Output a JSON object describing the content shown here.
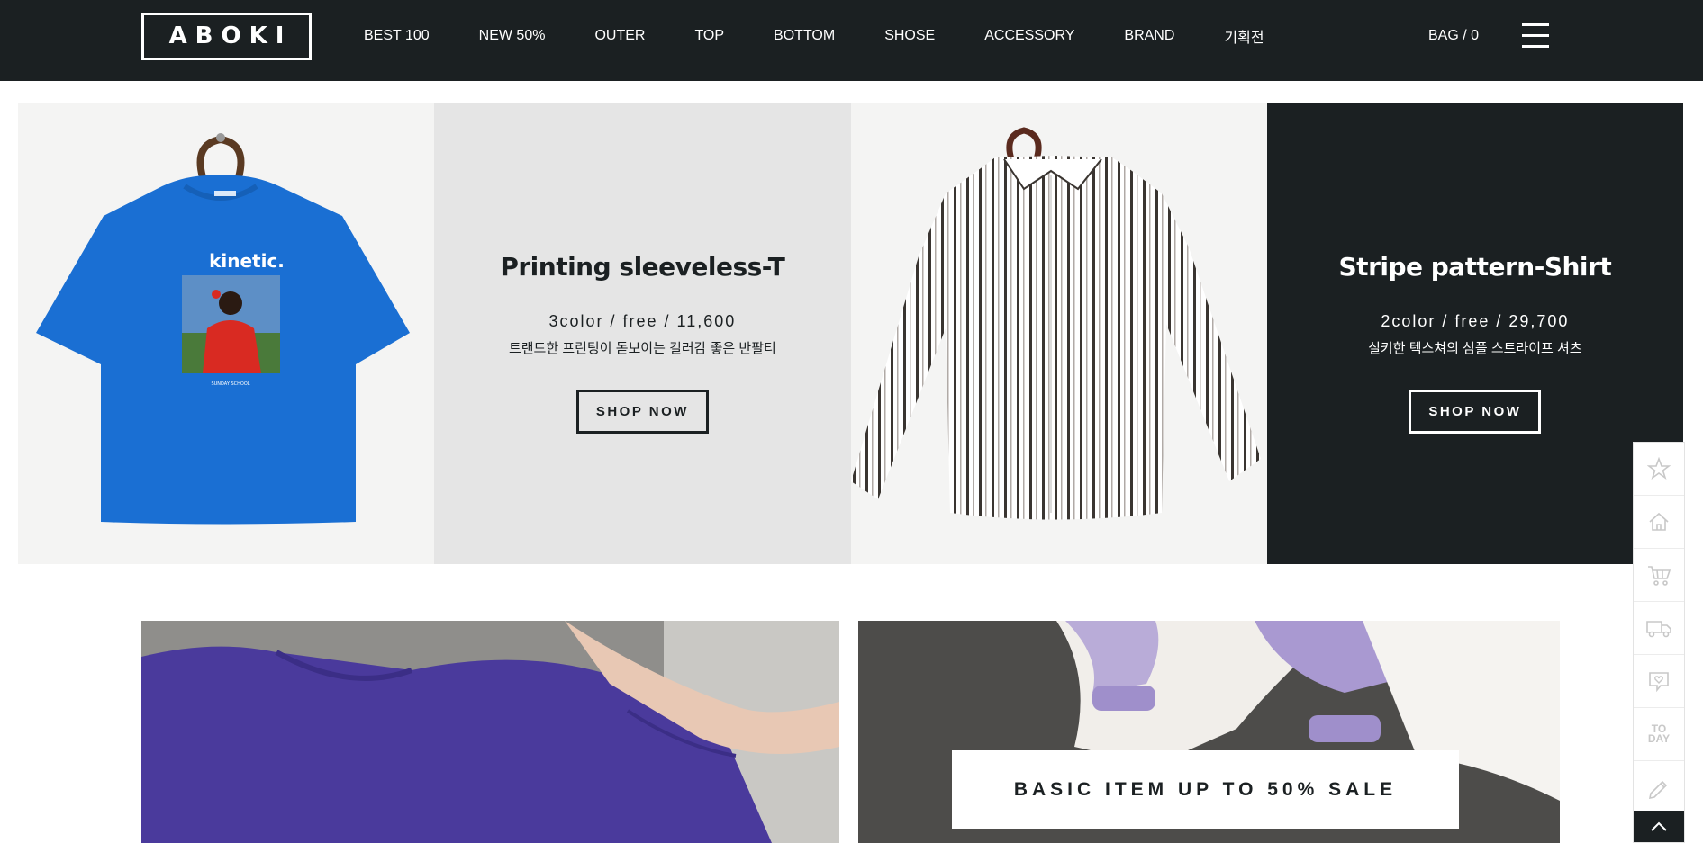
{
  "header": {
    "logo": "ABOKI",
    "nav": [
      "BEST 100",
      "NEW 50%",
      "OUTER",
      "TOP",
      "BOTTOM",
      "SHOSE",
      "ACCESSORY",
      "BRAND",
      "기획전"
    ],
    "bag": "BAG / 0",
    "menu_icon": "hamburger-menu-icon"
  },
  "banner": {
    "panels": [
      {
        "type": "image",
        "icon": "blue-kinetic-tshirt-image",
        "print_text": "kinetic.",
        "tag_text": "SUNDAY SCHOOL"
      },
      {
        "type": "text",
        "title": "Printing sleeveless-T",
        "meta": "3color / free / 11,600",
        "desc": "트랜드한 프린팅이 돋보이는 컬러감 좋은 반팔티",
        "button": "SHOP NOW"
      },
      {
        "type": "image",
        "icon": "stripe-shirt-image"
      },
      {
        "type": "text",
        "title": "Stripe pattern-Shirt",
        "meta": "2color / free / 29,700",
        "desc": "실키한 텍스쳐의 심플 스트라이프 셔츠",
        "button": "SHOP NOW"
      }
    ]
  },
  "tiles": {
    "left_icon": "purple-tshirt-model-image",
    "right_icon": "lavender-knit-model-image",
    "sale_text": "BASIC ITEM UP TO 50% SALE"
  },
  "quickbar": {
    "items": [
      "star-icon",
      "home-icon",
      "cart-icon",
      "truck-icon",
      "heart-message-icon",
      "today-icon",
      "pencil-icon"
    ],
    "today_label_top": "TO",
    "today_label_bottom": "DAY",
    "top_icon": "chevron-up-icon"
  },
  "colors": {
    "dark": "#1b2022",
    "light_panel": "#e5e5e5",
    "image_bg": "#f4f4f3",
    "shirt_blue": "#1a6fd3",
    "purple": "#4a3a9c"
  }
}
